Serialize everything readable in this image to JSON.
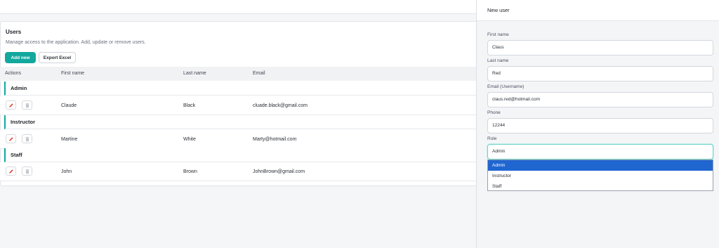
{
  "users": {
    "title": "Users",
    "subtitle": "Manage access to the application. Add, update or remove users.",
    "add_label": "Add new",
    "export_label": "Export Excel",
    "columns": [
      "Actions",
      "First name",
      "Last name",
      "Email"
    ],
    "groups": [
      {
        "name": "Admin",
        "rows": [
          {
            "first": "Claude",
            "last": "Black",
            "email": "cluade.black@gmail.com"
          }
        ]
      },
      {
        "name": "Instructor",
        "rows": [
          {
            "first": "Martine",
            "last": "White",
            "email": "Marty@hotmail.com"
          }
        ]
      },
      {
        "name": "Staff",
        "rows": [
          {
            "first": "John",
            "last": "Brown",
            "email": "JohnBrown@gmail.com"
          }
        ]
      }
    ]
  },
  "form": {
    "title": "New user",
    "first_name": {
      "label": "First name",
      "value": "Claus"
    },
    "last_name": {
      "label": "Last name",
      "value": "Red"
    },
    "email": {
      "label": "Email (Username)",
      "value": "claus.red@hotmail.com"
    },
    "phone": {
      "label": "Phone",
      "value": "12244"
    },
    "role": {
      "label": "Role",
      "value": "Admin",
      "options": [
        "Admin",
        "Instructor",
        "Staff"
      ]
    }
  },
  "icons": {
    "edit": "pencil-icon",
    "delete": "trash-icon"
  },
  "colors": {
    "accent": "#13a89e",
    "edit_icon": "#e0442f",
    "selected_option": "#1f66d1"
  }
}
